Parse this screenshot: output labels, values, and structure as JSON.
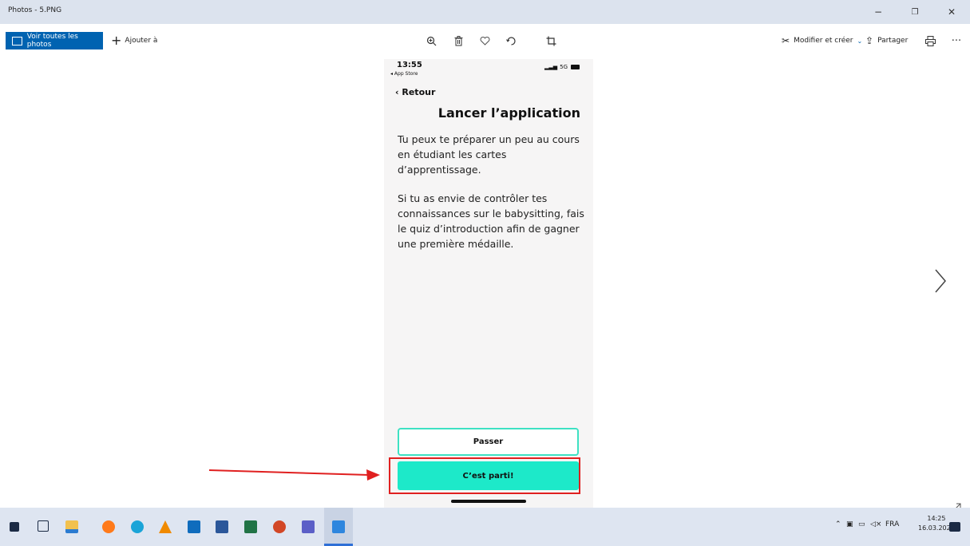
{
  "window": {
    "title": "Photos - 5.PNG",
    "controls": {
      "minimize": "−",
      "restore": "❐",
      "close": "✕"
    }
  },
  "toolbar": {
    "all_photos_label": "Voir toutes les photos",
    "add_label": "Ajouter à",
    "edit_label": "Modifier et créer",
    "share_label": "Partager",
    "icons": {
      "zoom": "zoom-icon",
      "delete": "trash-icon",
      "favorite": "heart-icon",
      "rotate": "rotate-icon",
      "crop": "crop-icon",
      "print": "print-icon",
      "more": "more-icon"
    }
  },
  "phone": {
    "time": "13:55",
    "back_app": "◂ App Store",
    "signal": "5G",
    "back_label": "Retour",
    "title": "Lancer l’application",
    "paragraph1": "Tu peux te préparer un peu au cours en étudiant les cartes d’apprentissage.",
    "paragraph2": "Si tu as envie de contrôler tes connaissances sur le babysitting, fais le quiz d’introduction afin de gagner une première médaille.",
    "skip_button": "Passer",
    "start_button": "C’est parti!"
  },
  "viewer": {
    "next_arrow": "›"
  },
  "taskbar": {
    "language": "FRA",
    "time": "14:25",
    "date": "16.03.2021",
    "icons": [
      "windows-start-icon",
      "task-view-icon",
      "file-explorer-icon",
      "firefox-icon",
      "edge-icon",
      "vlc-icon",
      "outlook-icon",
      "word-icon",
      "excel-icon",
      "powerpoint-icon",
      "teams-icon",
      "photos-icon"
    ]
  },
  "colors": {
    "accent": "#0063b1",
    "teal": "#1de9c9",
    "annotation_red": "#e02020"
  }
}
